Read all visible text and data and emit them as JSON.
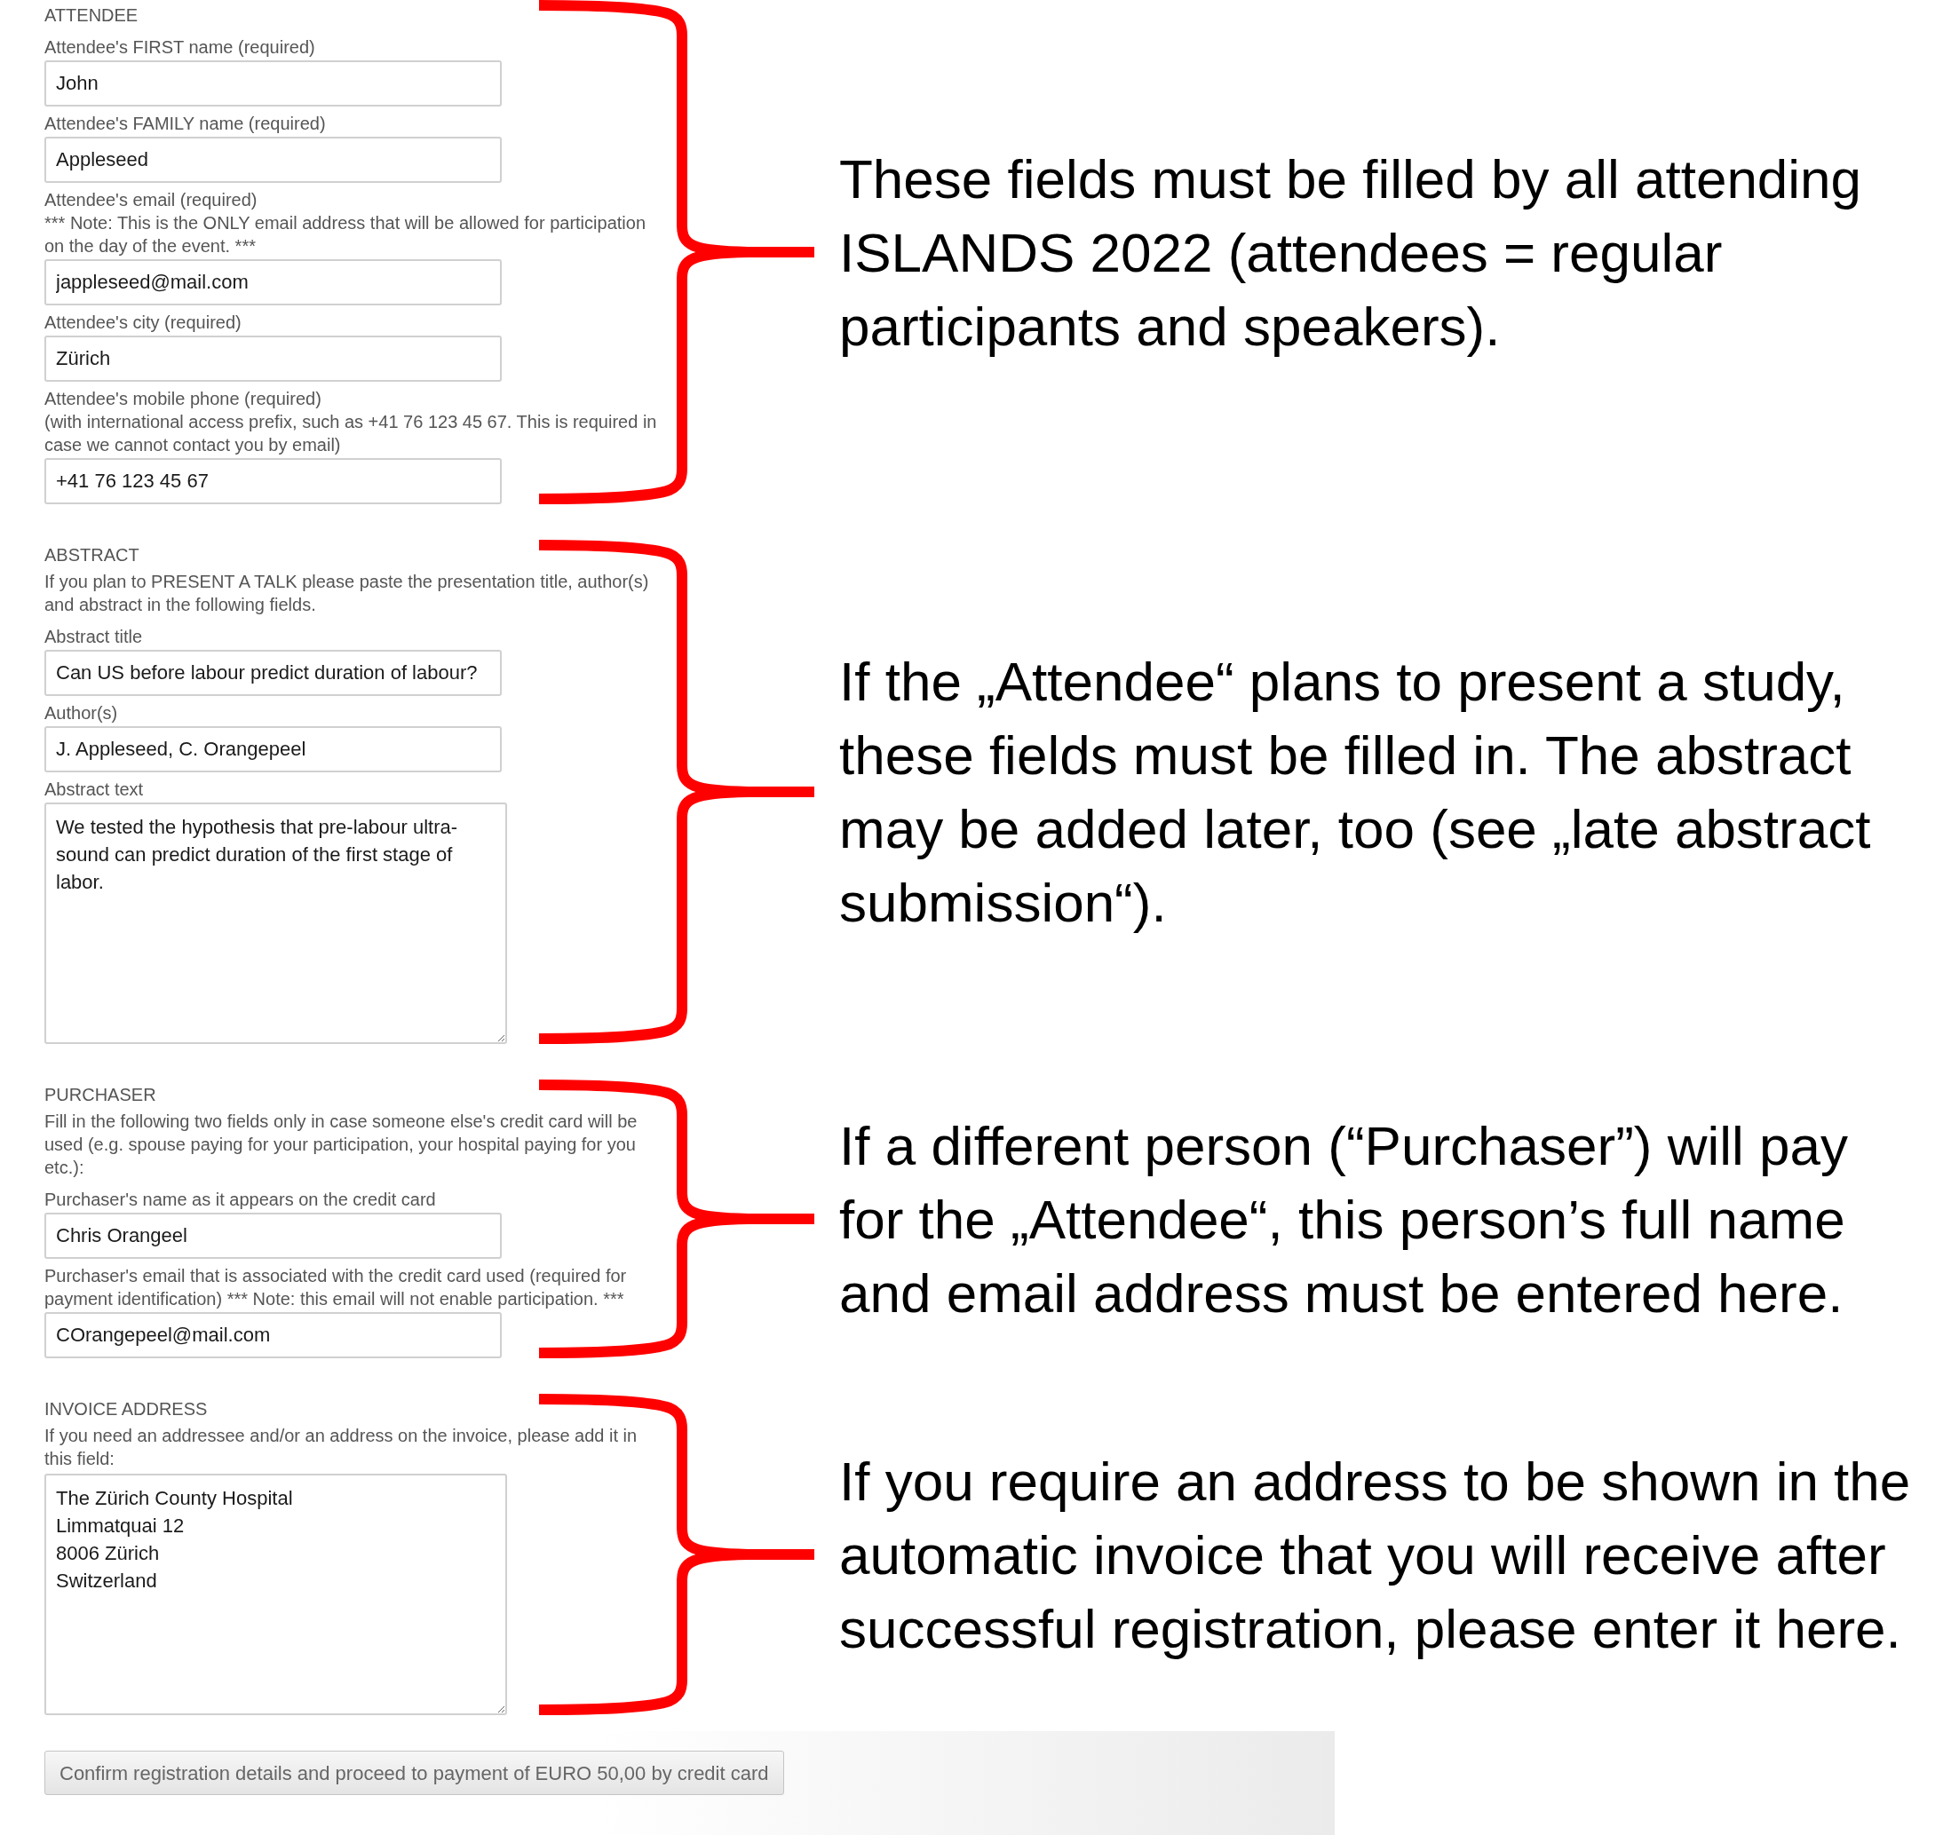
{
  "sections": [
    {
      "heading": "ATTENDEE",
      "fields": [
        {
          "label": "Attendee's FIRST name (required)",
          "kind": "input",
          "value": "John"
        },
        {
          "label": "Attendee's FAMILY name (required)",
          "kind": "input",
          "value": "Appleseed"
        },
        {
          "label": "Attendee's email (required)\n*** Note: This is the ONLY email address that will be allowed for participation on the day of the event. ***",
          "kind": "input",
          "value": "jappleseed@mail.com"
        },
        {
          "label": "Attendee's city (required)",
          "kind": "input",
          "value": "Zürich"
        },
        {
          "label": "Attendee's mobile phone (required)\n(with international access prefix, such as +41 76 123 45 67. This is required in case we cannot contact you by email)",
          "kind": "input",
          "value": "+41 76 123 45 67"
        }
      ],
      "annotation": "These fields must be filled by all attending\nISLANDS 2022 (attendees = regular\nparticipants and speakers)."
    },
    {
      "heading": "ABSTRACT",
      "intro": "If you plan to PRESENT A TALK please paste the presentation title, author(s) and abstract in the following fields.",
      "fields": [
        {
          "label": "Abstract title",
          "kind": "input",
          "value": "Can US before labour predict duration of labour?"
        },
        {
          "label": "Author(s)",
          "kind": "input",
          "value": "J. Appleseed, C. Orangepeel"
        },
        {
          "label": "Abstract text",
          "kind": "textarea",
          "value": "We tested the hypothesis that pre-labour ultra-sound can predict duration of the first stage of labor."
        }
      ],
      "annotation": "If the „Attendee“ plans to present a study,\nthese fields must be filled in. The abstract\nmay be added later, too (see „late abstract\nsubmission“)."
    },
    {
      "heading": "PURCHASER",
      "intro": "Fill in the following two fields only in case someone else's credit card will be used (e.g. spouse paying for your participation, your hospital paying for you etc.):",
      "fields": [
        {
          "label": "Purchaser's name as it appears on the credit card",
          "kind": "input",
          "value": "Chris Orangeel"
        },
        {
          "label": "Purchaser's email that is associated with the credit card used (required for payment identification) *** Note: this email will not enable participation. ***",
          "kind": "input",
          "value": "COrangepeel@mail.com"
        }
      ],
      "annotation": "If a different person (“Purchaser”) will pay\nfor the „Attendee“, this person’s full name\nand email address must be entered here."
    },
    {
      "heading": "INVOICE ADDRESS",
      "intro": "If you need an addressee and/or an address on the invoice, please add it in this field:",
      "fields": [
        {
          "kind": "textarea",
          "value": "The Zürich County Hospital\nLimmatquai 12\n8006 Zürich\nSwitzerland"
        }
      ],
      "annotation": "If you require an address to be shown in the\nautomatic invoice that you will receive after\nsuccessful registration, please enter it here."
    }
  ],
  "submit_button": {
    "label": "Confirm registration details and proceed to payment of EURO 50,00 by credit card"
  }
}
